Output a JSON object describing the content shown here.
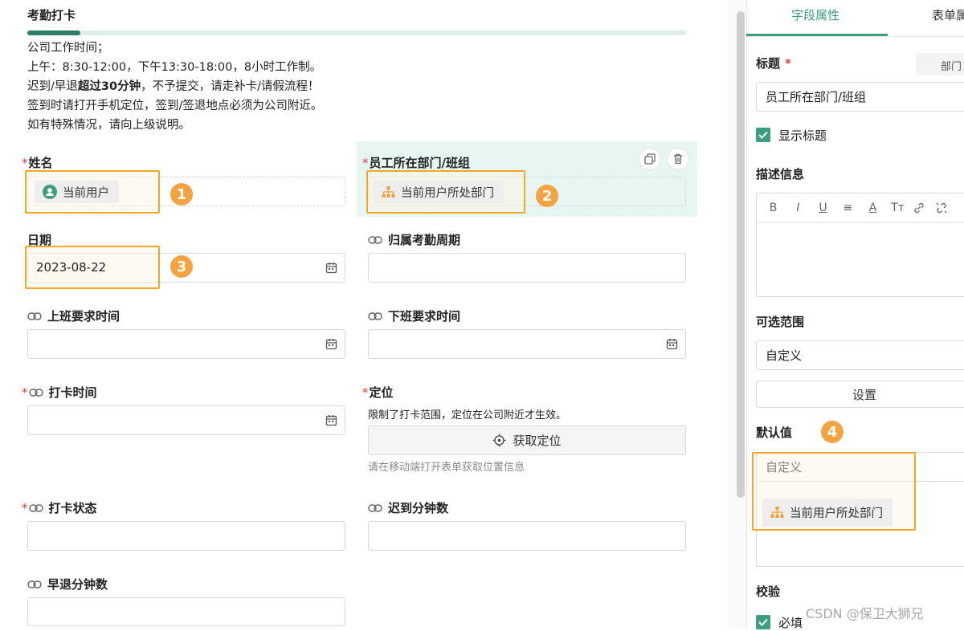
{
  "form": {
    "title": "考勤打卡",
    "description": {
      "line1": "公司工作时间；",
      "line2": "上午：8:30-12:00，下午13:30-18:00，8小时工作制。",
      "line3_pre": "迟到/早退",
      "line3_bold": "超过30分钟",
      "line3_post": "，不予提交，请走补卡/请假流程！",
      "line4": "签到时请打开手机定位，签到/签退地点必须为公司附近。",
      "line5": "如有特殊情况，请向上级说明。"
    },
    "required_mark": "*",
    "fields": {
      "name": {
        "label": "姓名",
        "chip": "当前用户"
      },
      "department": {
        "label": "员工所在部门/班组",
        "chip": "当前用户所处部门"
      },
      "date": {
        "label": "日期",
        "value": "2023-08-22"
      },
      "attendance_period": {
        "label": "归属考勤周期"
      },
      "work_start_time": {
        "label": "上班要求时间"
      },
      "work_end_time": {
        "label": "下班要求时间"
      },
      "clock_time": {
        "label": "打卡时间"
      },
      "location": {
        "label": "定位",
        "hint": "限制了打卡范围，定位在公司附近才生效。",
        "button": "获取定位",
        "sub_hint": "请在移动端打开表单获取位置信息"
      },
      "clock_status": {
        "label": "打卡状态"
      },
      "late_minutes": {
        "label": "迟到分钟数"
      },
      "early_leave_minutes": {
        "label": "早退分钟数"
      }
    }
  },
  "badges": [
    "1",
    "2",
    "3",
    "4"
  ],
  "panel": {
    "tabs": [
      "字段属性",
      "表单属"
    ],
    "title_label": "标题",
    "title_tag": "部门",
    "title_value": "员工所在部门/班组",
    "show_title": "显示标题",
    "description_label": "描述信息",
    "rte_tools": [
      "B",
      "I",
      "U",
      "≡",
      "A",
      "Tт"
    ],
    "range_label": "可选范围",
    "range_value": "自定义",
    "set_button": "设置",
    "default_label": "默认值",
    "default_value": "自定义",
    "default_chip": "当前用户所处部门",
    "validation_label": "校验",
    "required_label": "必填"
  },
  "watermark": "CSDN @保卫大狮兄",
  "colors": {
    "accent": "#3a9e7f",
    "highlight": "#f5a623",
    "badge": "#f4a340",
    "required": "#e0413b"
  }
}
